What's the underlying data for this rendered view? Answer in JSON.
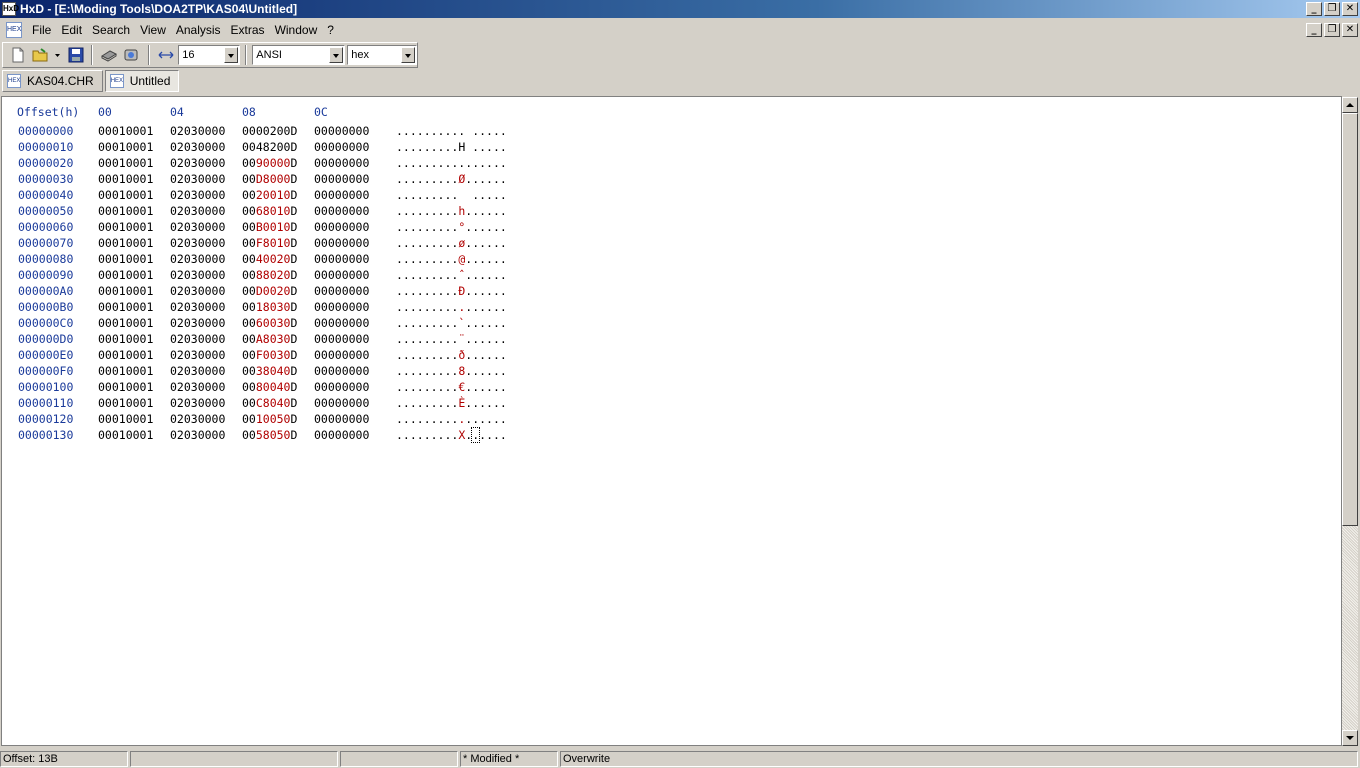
{
  "window": {
    "title": "HxD - [E:\\Moding Tools\\DOA2TP\\KAS04\\Untitled]",
    "app_icon": "hxd-icon"
  },
  "menu": [
    "File",
    "Edit",
    "Search",
    "View",
    "Analysis",
    "Extras",
    "Window",
    "?"
  ],
  "toolbar": {
    "bytes_per_row": "16",
    "charset": "ANSI",
    "offset_base": "hex"
  },
  "tabs": [
    {
      "label": "KAS04.CHR",
      "active": false
    },
    {
      "label": "Untitled",
      "active": true
    }
  ],
  "hex_header": {
    "offset": "Offset(h)",
    "cols": [
      "00",
      "04",
      "08",
      "0C"
    ]
  },
  "rows": [
    {
      "off": "00000000",
      "g0": "00010001",
      "g1": "02030000",
      "g2": [
        [
          "0000200",
          ""
        ],
        [
          "D",
          ""
        ]
      ],
      "g3": "00000000",
      "ascii": [
        [
          "..........",
          ""
        ],
        [
          " ",
          ""
        ],
        [
          ".....",
          ""
        ]
      ]
    },
    {
      "off": "00000010",
      "g0": "00010001",
      "g1": "02030000",
      "g2": [
        [
          "0048200",
          ""
        ],
        [
          "D",
          ""
        ]
      ],
      "g3": "00000000",
      "ascii": [
        [
          "........",
          ""
        ],
        [
          ".H",
          ""
        ],
        [
          " .....",
          ""
        ]
      ]
    },
    {
      "off": "00000020",
      "g0": "00010001",
      "g1": "02030000",
      "g2": [
        [
          "00",
          ""
        ],
        [
          "90000",
          "red"
        ],
        [
          "D",
          ""
        ]
      ],
      "g3": "00000000",
      "ascii": [
        [
          "..........",
          ""
        ],
        [
          ".",
          ""
        ],
        [
          ".....",
          ""
        ]
      ]
    },
    {
      "off": "00000030",
      "g0": "00010001",
      "g1": "02030000",
      "g2": [
        [
          "00",
          ""
        ],
        [
          "D8000",
          "red"
        ],
        [
          "D",
          ""
        ]
      ],
      "g3": "00000000",
      "ascii": [
        [
          "........",
          ""
        ],
        [
          ".",
          ""
        ],
        [
          "Ø",
          "red"
        ],
        [
          ".",
          ""
        ],
        [
          ".....",
          ""
        ]
      ]
    },
    {
      "off": "00000040",
      "g0": "00010001",
      "g1": "02030000",
      "g2": [
        [
          "00",
          ""
        ],
        [
          "20010",
          "red"
        ],
        [
          "D",
          ""
        ]
      ],
      "g3": "00000000",
      "ascii": [
        [
          "........",
          ""
        ],
        [
          ". ",
          ""
        ],
        [
          " ",
          ""
        ],
        [
          ".....",
          ""
        ]
      ]
    },
    {
      "off": "00000050",
      "g0": "00010001",
      "g1": "02030000",
      "g2": [
        [
          "00",
          ""
        ],
        [
          "68010",
          "red"
        ],
        [
          "D",
          ""
        ]
      ],
      "g3": "00000000",
      "ascii": [
        [
          "........",
          ""
        ],
        [
          ".",
          ""
        ],
        [
          "h",
          "red"
        ],
        [
          ".",
          ""
        ],
        [
          ".....",
          ""
        ]
      ]
    },
    {
      "off": "00000060",
      "g0": "00010001",
      "g1": "02030000",
      "g2": [
        [
          "00",
          ""
        ],
        [
          "B0010",
          "red"
        ],
        [
          "D",
          ""
        ]
      ],
      "g3": "00000000",
      "ascii": [
        [
          "........",
          ""
        ],
        [
          ".",
          ""
        ],
        [
          "°",
          "red"
        ],
        [
          ".",
          ""
        ],
        [
          ".....",
          ""
        ]
      ]
    },
    {
      "off": "00000070",
      "g0": "00010001",
      "g1": "02030000",
      "g2": [
        [
          "00",
          ""
        ],
        [
          "F8010",
          "red"
        ],
        [
          "D",
          ""
        ]
      ],
      "g3": "00000000",
      "ascii": [
        [
          "........",
          ""
        ],
        [
          ".",
          ""
        ],
        [
          "ø",
          "red"
        ],
        [
          ".",
          ""
        ],
        [
          ".....",
          ""
        ]
      ]
    },
    {
      "off": "00000080",
      "g0": "00010001",
      "g1": "02030000",
      "g2": [
        [
          "00",
          ""
        ],
        [
          "40020",
          "red"
        ],
        [
          "D",
          ""
        ]
      ],
      "g3": "00000000",
      "ascii": [
        [
          "........",
          ""
        ],
        [
          ".",
          ""
        ],
        [
          "@",
          "red"
        ],
        [
          ".",
          ""
        ],
        [
          ".....",
          ""
        ]
      ]
    },
    {
      "off": "00000090",
      "g0": "00010001",
      "g1": "02030000",
      "g2": [
        [
          "00",
          ""
        ],
        [
          "88020",
          "red"
        ],
        [
          "D",
          ""
        ]
      ],
      "g3": "00000000",
      "ascii": [
        [
          "........",
          ""
        ],
        [
          ".",
          ""
        ],
        [
          "ˆ",
          "red"
        ],
        [
          ".",
          ""
        ],
        [
          ".....",
          ""
        ]
      ]
    },
    {
      "off": "000000A0",
      "g0": "00010001",
      "g1": "02030000",
      "g2": [
        [
          "00",
          ""
        ],
        [
          "D0020",
          "red"
        ],
        [
          "D",
          ""
        ]
      ],
      "g3": "00000000",
      "ascii": [
        [
          "........",
          ""
        ],
        [
          ".",
          ""
        ],
        [
          "Ð",
          "red"
        ],
        [
          ".",
          ""
        ],
        [
          ".....",
          ""
        ]
      ]
    },
    {
      "off": "000000B0",
      "g0": "00010001",
      "g1": "02030000",
      "g2": [
        [
          "00",
          ""
        ],
        [
          "18030",
          "red"
        ],
        [
          "D",
          ""
        ]
      ],
      "g3": "00000000",
      "ascii": [
        [
          "........",
          ""
        ],
        [
          ".",
          ""
        ],
        [
          ".",
          "red"
        ],
        [
          ".",
          ""
        ],
        [
          ".....",
          ""
        ]
      ]
    },
    {
      "off": "000000C0",
      "g0": "00010001",
      "g1": "02030000",
      "g2": [
        [
          "00",
          ""
        ],
        [
          "60030",
          "red"
        ],
        [
          "D",
          ""
        ]
      ],
      "g3": "00000000",
      "ascii": [
        [
          "........",
          ""
        ],
        [
          ".",
          ""
        ],
        [
          "`",
          "red"
        ],
        [
          ".",
          ""
        ],
        [
          ".....",
          ""
        ]
      ]
    },
    {
      "off": "000000D0",
      "g0": "00010001",
      "g1": "02030000",
      "g2": [
        [
          "00",
          ""
        ],
        [
          "A8030",
          "red"
        ],
        [
          "D",
          ""
        ]
      ],
      "g3": "00000000",
      "ascii": [
        [
          "........",
          ""
        ],
        [
          ".",
          ""
        ],
        [
          "¨",
          "red"
        ],
        [
          ".",
          ""
        ],
        [
          ".....",
          ""
        ]
      ]
    },
    {
      "off": "000000E0",
      "g0": "00010001",
      "g1": "02030000",
      "g2": [
        [
          "00",
          ""
        ],
        [
          "F0030",
          "red"
        ],
        [
          "D",
          ""
        ]
      ],
      "g3": "00000000",
      "ascii": [
        [
          "........",
          ""
        ],
        [
          ".",
          ""
        ],
        [
          "ð",
          "red"
        ],
        [
          ".",
          ""
        ],
        [
          ".....",
          ""
        ]
      ]
    },
    {
      "off": "000000F0",
      "g0": "00010001",
      "g1": "02030000",
      "g2": [
        [
          "00",
          ""
        ],
        [
          "38040",
          "red"
        ],
        [
          "D",
          ""
        ]
      ],
      "g3": "00000000",
      "ascii": [
        [
          "........",
          ""
        ],
        [
          ".",
          ""
        ],
        [
          "8",
          "red"
        ],
        [
          ".",
          ""
        ],
        [
          ".....",
          ""
        ]
      ]
    },
    {
      "off": "00000100",
      "g0": "00010001",
      "g1": "02030000",
      "g2": [
        [
          "00",
          ""
        ],
        [
          "80040",
          "red"
        ],
        [
          "D",
          ""
        ]
      ],
      "g3": "00000000",
      "ascii": [
        [
          "........",
          ""
        ],
        [
          ".",
          ""
        ],
        [
          "€",
          "red"
        ],
        [
          ".",
          ""
        ],
        [
          ".....",
          ""
        ]
      ]
    },
    {
      "off": "00000110",
      "g0": "00010001",
      "g1": "02030000",
      "g2": [
        [
          "00",
          ""
        ],
        [
          "C8040",
          "red"
        ],
        [
          "D",
          ""
        ]
      ],
      "g3": "00000000",
      "ascii": [
        [
          "........",
          ""
        ],
        [
          ".",
          ""
        ],
        [
          "È",
          "red"
        ],
        [
          ".",
          ""
        ],
        [
          ".....",
          ""
        ]
      ]
    },
    {
      "off": "00000120",
      "g0": "00010001",
      "g1": "02030000",
      "g2": [
        [
          "00",
          ""
        ],
        [
          "10050",
          "red"
        ],
        [
          "D",
          ""
        ]
      ],
      "g3": "00000000",
      "ascii": [
        [
          "........",
          ""
        ],
        [
          ".",
          ""
        ],
        [
          ".",
          "red"
        ],
        [
          ".",
          ""
        ],
        [
          ".....",
          ""
        ]
      ]
    },
    {
      "off": "00000130",
      "g0": "00010001",
      "g1": "02030000",
      "g2": [
        [
          "00",
          ""
        ],
        [
          "58050",
          "red"
        ],
        [
          "D",
          ""
        ]
      ],
      "g3": "00000000",
      "ascii": [
        [
          "........",
          ""
        ],
        [
          ".",
          ""
        ],
        [
          "X",
          "red"
        ],
        [
          ".",
          ""
        ],
        [
          ".",
          "caret"
        ],
        [
          "....",
          ""
        ]
      ]
    }
  ],
  "status": {
    "offset": "Offset: 13B",
    "modified": "* Modified *",
    "mode": "Overwrite"
  },
  "colors": {
    "title_start": "#0a246a",
    "title_end": "#a6caf0",
    "offset_blue": "#1a3a9a",
    "modified_red": "#b00000"
  }
}
